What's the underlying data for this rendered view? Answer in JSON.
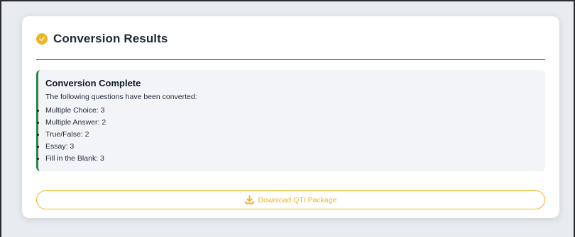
{
  "card": {
    "title": "Conversion Results",
    "icon": "check-circle-icon",
    "accent_color": "#f0b429"
  },
  "result": {
    "title": "Conversion Complete",
    "description": "The following questions have been converted:",
    "items": [
      "Multiple Choice: 3",
      "Multiple Answer: 2",
      "True/False: 2",
      "Essay: 3",
      "Fill in the Blank: 3"
    ],
    "status_color": "#27864a"
  },
  "download": {
    "label": "Download QTI Package",
    "icon": "download-icon",
    "color": "#f0b429"
  }
}
